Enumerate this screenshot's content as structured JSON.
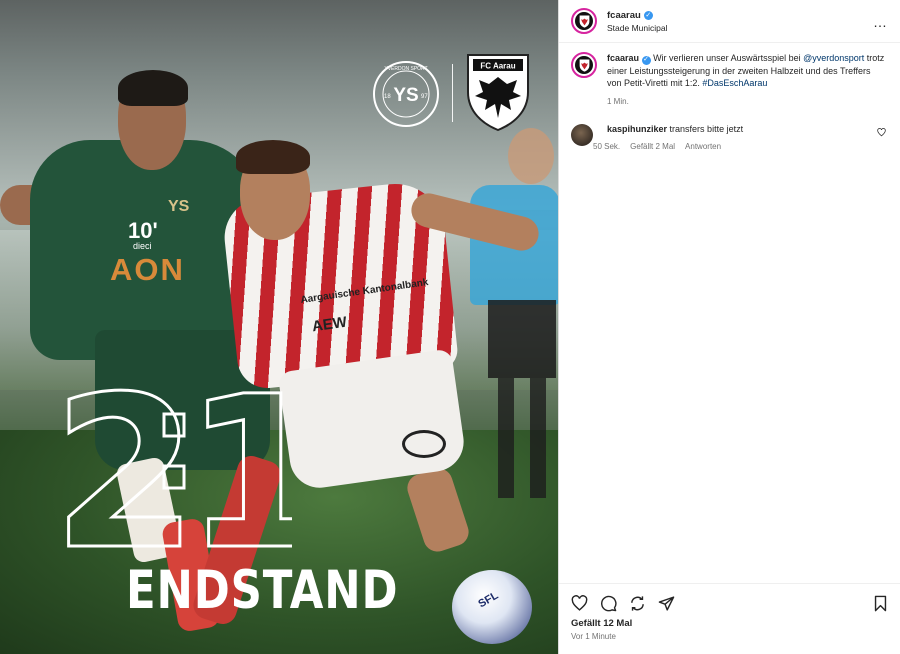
{
  "post": {
    "score_home": "2",
    "score_away": "1",
    "overlay_label": "ENDSTAND",
    "yverdon_crest_text": "YVERDON SPORT",
    "yverdon_crest_initials": "YS",
    "yverdon_year_left": "18",
    "yverdon_year_right": "97",
    "aarau_crest_text": "FC Aarau",
    "jersey_sponsor_green": "AON",
    "jersey_sponsor_green_top": "10",
    "jersey_sponsor_green_sub": "dieci",
    "jersey_sponsor_red": "AEW",
    "jersey_sponsor_red_bank": "Aargauische Kantonalbank",
    "ball_text": "SFL"
  },
  "header": {
    "username": "fcaarau",
    "location": "Stade Municipal",
    "more": "…"
  },
  "caption": {
    "username": "fcaarau",
    "text_1": "Wir verlieren unser Auswärtsspiel bei ",
    "mention": "@yverdonsport",
    "text_2": " trotz einer Leistungssteigerung in der zweiten Halbzeit und des Treffers von Petit-Viretti mit 1:2. ",
    "hashtag": "#DasEschAarau",
    "time": "1 Min."
  },
  "comments": [
    {
      "username": "kaspihunziker",
      "text": "transfers bitte jetzt",
      "time": "50 Sek.",
      "likes": "Gefällt 2 Mal",
      "reply": "Antworten"
    }
  ],
  "footer": {
    "likes": "Gefällt 12 Mal",
    "ago": "Vor 1 Minute"
  },
  "icons": [
    "heart-icon",
    "comment-icon",
    "repost-icon",
    "share-icon",
    "bookmark-icon",
    "more-icon",
    "verified-icon"
  ],
  "colors": {
    "verified": "#3897f0",
    "link": "#00376b",
    "meta": "#737373",
    "aarau_red": "#c3242c",
    "yverdon_green": "#23543a"
  }
}
